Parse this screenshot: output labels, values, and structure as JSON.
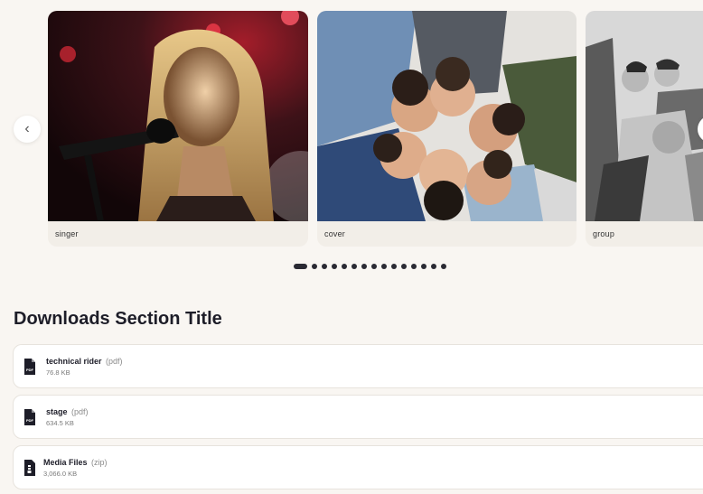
{
  "carousel": {
    "slides": [
      {
        "label": "singer"
      },
      {
        "label": "cover"
      },
      {
        "label": "group"
      }
    ],
    "dot_count": 15,
    "active_dot": 0,
    "prev_icon": "chevron-left-icon",
    "next_icon": "chevron-right-icon"
  },
  "downloads": {
    "title": "Downloads Section Title",
    "items": [
      {
        "name": "technical rider",
        "ext": "(pdf)",
        "size": "76.8 KB",
        "icon": "pdf-file-icon"
      },
      {
        "name": "stage",
        "ext": "(pdf)",
        "size": "634.5 KB",
        "icon": "pdf-file-icon"
      },
      {
        "name": "Media Files",
        "ext": "(zip)",
        "size": "3,066.0 KB",
        "icon": "zip-file-icon"
      }
    ]
  },
  "colors": {
    "background": "#f9f6f2",
    "card": "#ffffff",
    "text": "#1d1d28",
    "muted": "#8a8a8a"
  }
}
